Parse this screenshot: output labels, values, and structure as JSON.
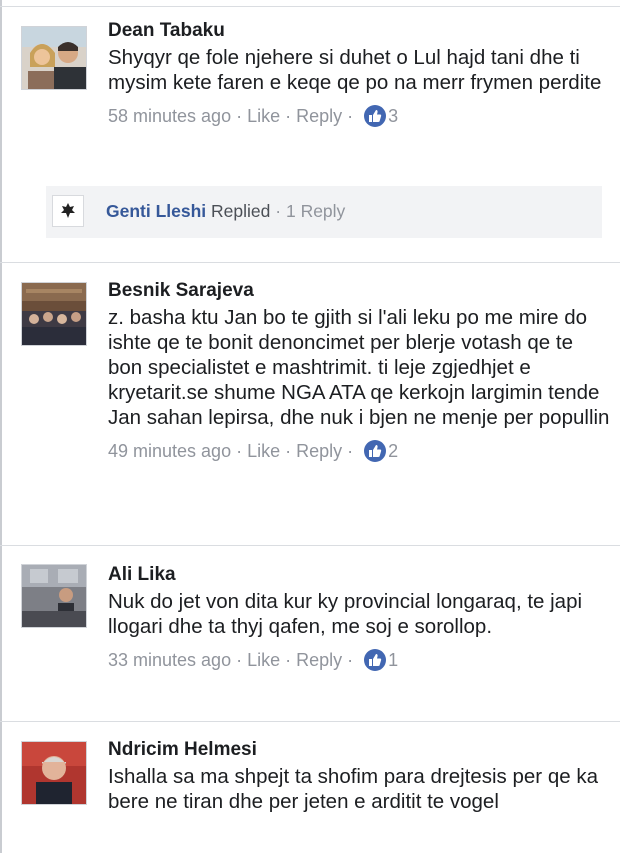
{
  "comments": [
    {
      "author": "Dean Tabaku",
      "text": "Shyqyr qe fole njehere si duhet o Lul hajd tani dhe ti mysim kete faren e keqe qe po na merr frymen perdite",
      "time": "58 minutes ago",
      "like_label": "Like",
      "reply_label": "Reply",
      "reactions": "3"
    },
    {
      "author": "Besnik Sarajeva",
      "text": "z. basha ktu Jan bo te gjith si l'ali leku po me mire do ishte qe te bonit denoncimet per blerje votash qe te bon specialistet e mashtrimit. ti leje zgjedhjet e kryetarit.se shume NGA ATA qe kerkojn largimin tende Jan sahan lepirsa, dhe nuk i bjen ne menje per popullin",
      "time": "49 minutes ago",
      "like_label": "Like",
      "reply_label": "Reply",
      "reactions": "2"
    },
    {
      "author": "Ali Lika",
      "text": "Nuk do jet von dita kur ky provincial longaraq, te japi llogari dhe ta thyj qafen, me soj e sorollop.",
      "time": "33 minutes ago",
      "like_label": "Like",
      "reply_label": "Reply",
      "reactions": "1"
    },
    {
      "author": "Ndricim Helmesi",
      "text": "Ishalla sa ma shpejt ta shofim  para drejtesis per qe ka bere ne tiran dhe per jeten e arditit te vogel"
    }
  ],
  "reply_summary": {
    "name": "Genti Lleshi",
    "verb": "Replied",
    "separator": "·",
    "count": "1 Reply"
  },
  "meta_separator": "·",
  "colors": {
    "link": "#365899",
    "meta": "#90949c",
    "like_badge": "#4267b2",
    "reply_bg": "#f2f3f5",
    "divider": "#dadde1"
  },
  "icons": [
    "thumbs-up-icon"
  ]
}
